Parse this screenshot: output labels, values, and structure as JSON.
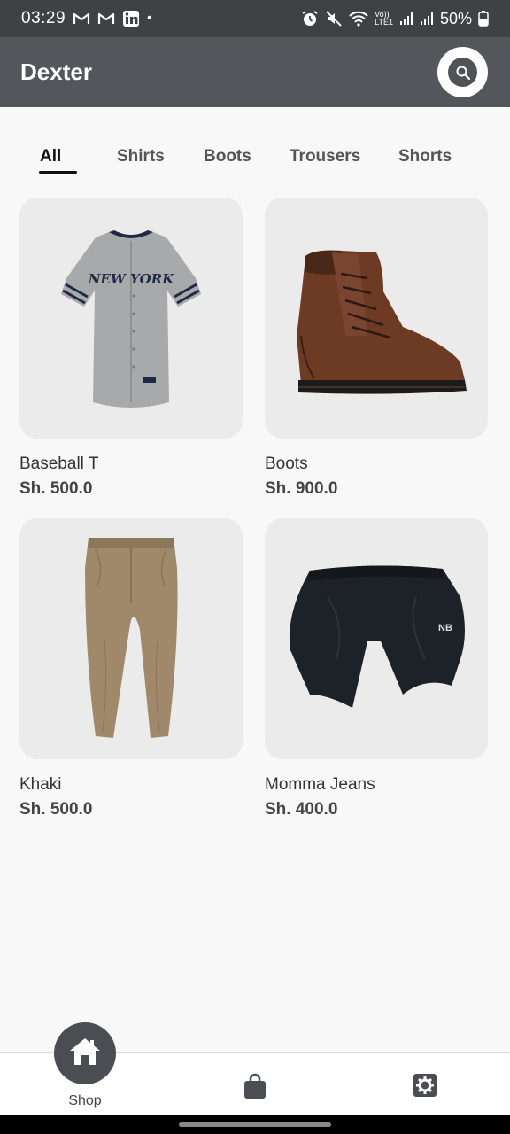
{
  "status_bar": {
    "time": "03:29",
    "notification_icons": [
      "gmail-icon",
      "gmail-icon",
      "linkedin-icon"
    ],
    "dot": "•",
    "signal_label_top": "Vo))",
    "signal_label_bottom": "LTE1",
    "battery": "50%"
  },
  "app_bar": {
    "title": "Dexter"
  },
  "tabs": [
    {
      "label": "All",
      "active": true
    },
    {
      "label": "Shirts",
      "active": false
    },
    {
      "label": "Boots",
      "active": false
    },
    {
      "label": "Trousers",
      "active": false
    },
    {
      "label": "Shorts",
      "active": false
    }
  ],
  "products": [
    {
      "name": "Baseball T",
      "price": "Sh. 500.0",
      "image": "baseball-jersey"
    },
    {
      "name": "Boots",
      "price": "Sh. 900.0",
      "image": "brown-boot"
    },
    {
      "name": "Khaki",
      "price": "Sh. 500.0",
      "image": "khaki-trousers"
    },
    {
      "name": "Momma Jeans",
      "price": "Sh. 400.0",
      "image": "black-shorts"
    }
  ],
  "jersey_text": "NEW YORK",
  "bottom_nav": {
    "home_label": "Shop"
  },
  "colors": {
    "status_bar": "#3f4244",
    "app_bar": "#53575b",
    "background": "#f8f8f8",
    "card": "#ebebeb"
  }
}
